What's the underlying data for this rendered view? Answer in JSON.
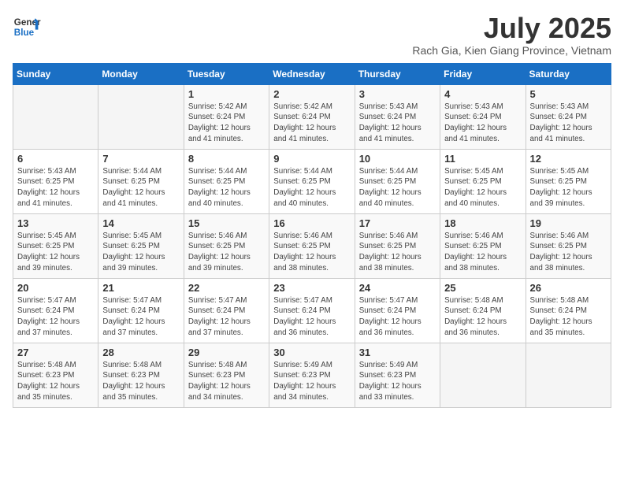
{
  "header": {
    "logo_line1": "General",
    "logo_line2": "Blue",
    "month_title": "July 2025",
    "location": "Rach Gia, Kien Giang Province, Vietnam"
  },
  "weekdays": [
    "Sunday",
    "Monday",
    "Tuesday",
    "Wednesday",
    "Thursday",
    "Friday",
    "Saturday"
  ],
  "weeks": [
    [
      {
        "day": "",
        "info": ""
      },
      {
        "day": "",
        "info": ""
      },
      {
        "day": "1",
        "info": "Sunrise: 5:42 AM\nSunset: 6:24 PM\nDaylight: 12 hours and 41 minutes."
      },
      {
        "day": "2",
        "info": "Sunrise: 5:42 AM\nSunset: 6:24 PM\nDaylight: 12 hours and 41 minutes."
      },
      {
        "day": "3",
        "info": "Sunrise: 5:43 AM\nSunset: 6:24 PM\nDaylight: 12 hours and 41 minutes."
      },
      {
        "day": "4",
        "info": "Sunrise: 5:43 AM\nSunset: 6:24 PM\nDaylight: 12 hours and 41 minutes."
      },
      {
        "day": "5",
        "info": "Sunrise: 5:43 AM\nSunset: 6:24 PM\nDaylight: 12 hours and 41 minutes."
      }
    ],
    [
      {
        "day": "6",
        "info": "Sunrise: 5:43 AM\nSunset: 6:25 PM\nDaylight: 12 hours and 41 minutes."
      },
      {
        "day": "7",
        "info": "Sunrise: 5:44 AM\nSunset: 6:25 PM\nDaylight: 12 hours and 41 minutes."
      },
      {
        "day": "8",
        "info": "Sunrise: 5:44 AM\nSunset: 6:25 PM\nDaylight: 12 hours and 40 minutes."
      },
      {
        "day": "9",
        "info": "Sunrise: 5:44 AM\nSunset: 6:25 PM\nDaylight: 12 hours and 40 minutes."
      },
      {
        "day": "10",
        "info": "Sunrise: 5:44 AM\nSunset: 6:25 PM\nDaylight: 12 hours and 40 minutes."
      },
      {
        "day": "11",
        "info": "Sunrise: 5:45 AM\nSunset: 6:25 PM\nDaylight: 12 hours and 40 minutes."
      },
      {
        "day": "12",
        "info": "Sunrise: 5:45 AM\nSunset: 6:25 PM\nDaylight: 12 hours and 39 minutes."
      }
    ],
    [
      {
        "day": "13",
        "info": "Sunrise: 5:45 AM\nSunset: 6:25 PM\nDaylight: 12 hours and 39 minutes."
      },
      {
        "day": "14",
        "info": "Sunrise: 5:45 AM\nSunset: 6:25 PM\nDaylight: 12 hours and 39 minutes."
      },
      {
        "day": "15",
        "info": "Sunrise: 5:46 AM\nSunset: 6:25 PM\nDaylight: 12 hours and 39 minutes."
      },
      {
        "day": "16",
        "info": "Sunrise: 5:46 AM\nSunset: 6:25 PM\nDaylight: 12 hours and 38 minutes."
      },
      {
        "day": "17",
        "info": "Sunrise: 5:46 AM\nSunset: 6:25 PM\nDaylight: 12 hours and 38 minutes."
      },
      {
        "day": "18",
        "info": "Sunrise: 5:46 AM\nSunset: 6:25 PM\nDaylight: 12 hours and 38 minutes."
      },
      {
        "day": "19",
        "info": "Sunrise: 5:46 AM\nSunset: 6:25 PM\nDaylight: 12 hours and 38 minutes."
      }
    ],
    [
      {
        "day": "20",
        "info": "Sunrise: 5:47 AM\nSunset: 6:24 PM\nDaylight: 12 hours and 37 minutes."
      },
      {
        "day": "21",
        "info": "Sunrise: 5:47 AM\nSunset: 6:24 PM\nDaylight: 12 hours and 37 minutes."
      },
      {
        "day": "22",
        "info": "Sunrise: 5:47 AM\nSunset: 6:24 PM\nDaylight: 12 hours and 37 minutes."
      },
      {
        "day": "23",
        "info": "Sunrise: 5:47 AM\nSunset: 6:24 PM\nDaylight: 12 hours and 36 minutes."
      },
      {
        "day": "24",
        "info": "Sunrise: 5:47 AM\nSunset: 6:24 PM\nDaylight: 12 hours and 36 minutes."
      },
      {
        "day": "25",
        "info": "Sunrise: 5:48 AM\nSunset: 6:24 PM\nDaylight: 12 hours and 36 minutes."
      },
      {
        "day": "26",
        "info": "Sunrise: 5:48 AM\nSunset: 6:24 PM\nDaylight: 12 hours and 35 minutes."
      }
    ],
    [
      {
        "day": "27",
        "info": "Sunrise: 5:48 AM\nSunset: 6:23 PM\nDaylight: 12 hours and 35 minutes."
      },
      {
        "day": "28",
        "info": "Sunrise: 5:48 AM\nSunset: 6:23 PM\nDaylight: 12 hours and 35 minutes."
      },
      {
        "day": "29",
        "info": "Sunrise: 5:48 AM\nSunset: 6:23 PM\nDaylight: 12 hours and 34 minutes."
      },
      {
        "day": "30",
        "info": "Sunrise: 5:49 AM\nSunset: 6:23 PM\nDaylight: 12 hours and 34 minutes."
      },
      {
        "day": "31",
        "info": "Sunrise: 5:49 AM\nSunset: 6:23 PM\nDaylight: 12 hours and 33 minutes."
      },
      {
        "day": "",
        "info": ""
      },
      {
        "day": "",
        "info": ""
      }
    ]
  ]
}
